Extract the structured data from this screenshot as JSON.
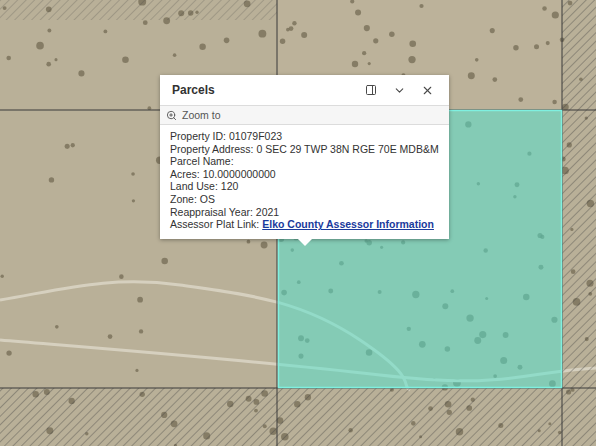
{
  "map": {
    "parcel_selected": true
  },
  "popup": {
    "title": "Parcels",
    "action": "Zoom to",
    "fields": [
      {
        "label": "Property ID:",
        "value": "01079F023",
        "kind": "text"
      },
      {
        "label": "Property Address:",
        "value": "0 SEC 29 TWP 38N RGE 70E MDB&M",
        "kind": "text"
      },
      {
        "label": "Parcel Name:",
        "value": "",
        "kind": "text"
      },
      {
        "label": "Acres:",
        "value": "10.0000000000",
        "kind": "text"
      },
      {
        "label": "Land Use:",
        "value": "120",
        "kind": "text"
      },
      {
        "label": "Zone:",
        "value": "OS",
        "kind": "text"
      },
      {
        "label": "Reappraisal Year:",
        "value": "2021",
        "kind": "text"
      },
      {
        "label": "Assessor Plat Link:",
        "value": "Elko County Assessor Information",
        "kind": "link"
      }
    ]
  }
}
